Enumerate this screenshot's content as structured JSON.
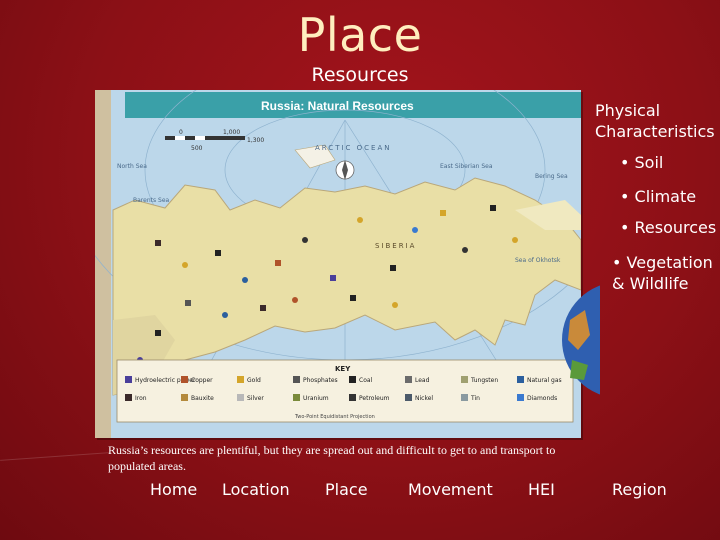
{
  "slide": {
    "title": "Place",
    "subtitle": "Resources",
    "caption": "Russia’s resources are plentiful, but they are spread out and difficult to get to and transport to populated areas."
  },
  "map": {
    "title": "Russia: Natural Resources",
    "scale_labels": [
      "0",
      "500",
      "1,000",
      "1,300"
    ],
    "region_labels": {
      "arctic_ocean": "ARCTIC OCEAN",
      "siberia": "SIBERIA",
      "north_sea": "North Sea",
      "barents_sea": "Barents Sea",
      "east_siberian_sea": "East Siberian Sea",
      "bering_sea": "Bering Sea",
      "sea_of_okhotsk": "Sea of Okhotsk"
    },
    "key_title": "KEY",
    "key_items": [
      {
        "label": "Hydroelectric power",
        "color": "#4a3f9a"
      },
      {
        "label": "Copper",
        "color": "#b0532a"
      },
      {
        "label": "Gold",
        "color": "#d4a52a"
      },
      {
        "label": "Phosphates",
        "color": "#555555"
      },
      {
        "label": "Coal",
        "color": "#222222"
      },
      {
        "label": "Lead",
        "color": "#6b6b6b"
      },
      {
        "label": "Tungsten",
        "color": "#a0a070"
      },
      {
        "label": "Natural gas",
        "color": "#2b5f9e"
      },
      {
        "label": "Iron",
        "color": "#3b2a2a"
      },
      {
        "label": "Bauxite",
        "color": "#b48a3c"
      },
      {
        "label": "Silver",
        "color": "#b8b8b8"
      },
      {
        "label": "Uranium",
        "color": "#7a8a3a"
      },
      {
        "label": "Petroleum",
        "color": "#333333"
      },
      {
        "label": "Nickel",
        "color": "#4c5a6a"
      },
      {
        "label": "Tin",
        "color": "#8a9aa0"
      },
      {
        "label": "Diamonds",
        "color": "#3a7ad0"
      }
    ],
    "projection_note": "Two-Point Equidistant Projection"
  },
  "side_panel": {
    "heading": "Physical Characteristics",
    "bullets": [
      "• Soil",
      "• Climate",
      "• Resources",
      "• Vegetation & Wildlife"
    ]
  },
  "nav": {
    "home": "Home",
    "location": "Location",
    "place": "Place",
    "movement": "Movement",
    "hei": "HEI",
    "region": "Region"
  },
  "colors": {
    "background": "#8c1016",
    "title": "#ffeebf",
    "map_header": "#3aa0a8",
    "ocean": "#bcd7ea",
    "land": "#e9dfa6"
  }
}
